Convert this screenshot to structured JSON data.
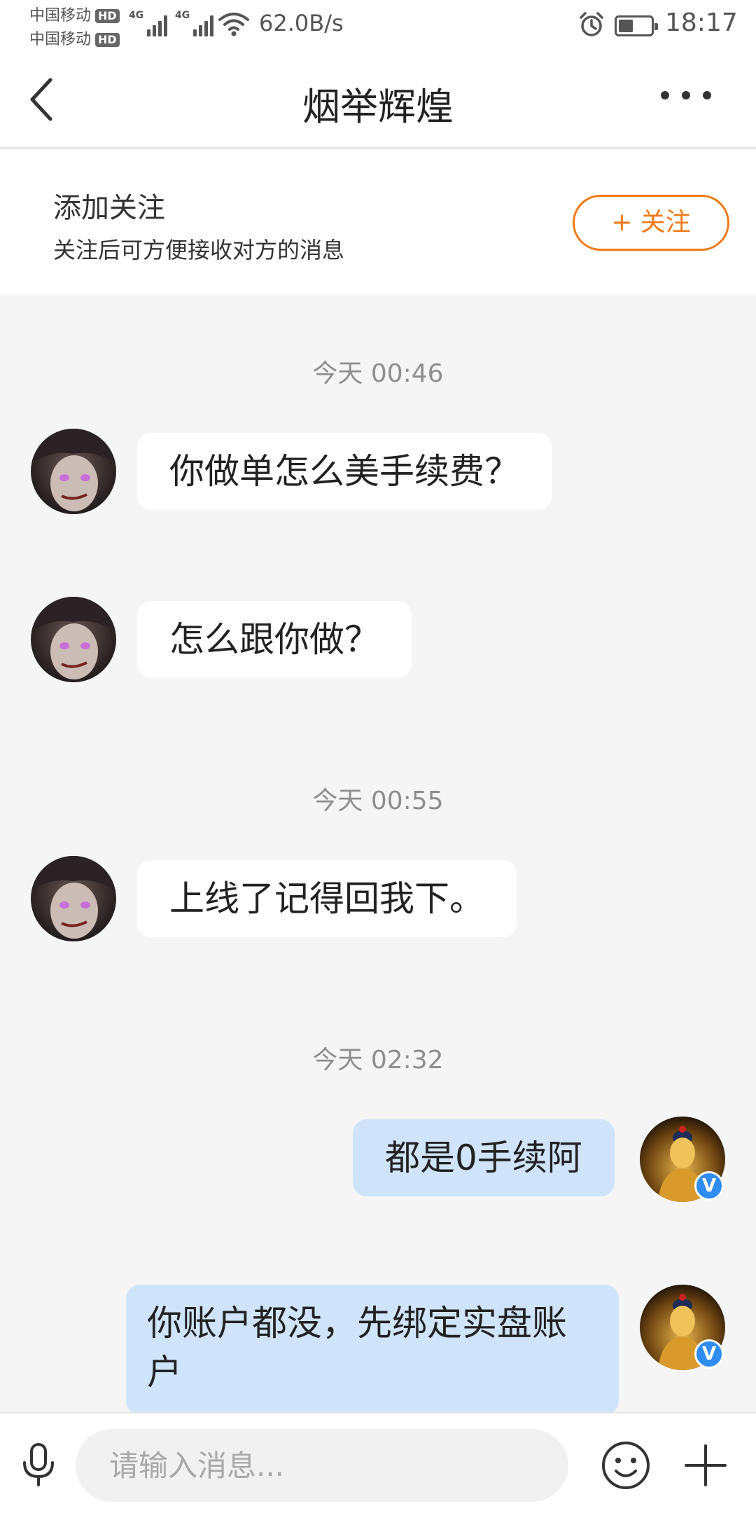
{
  "status_bar": {
    "carrier_1": "中国移动",
    "carrier_2": "中国移动",
    "hd_label": "HD",
    "network_tag": "4G",
    "net_speed": "62.0B/s",
    "time": "18:17"
  },
  "header": {
    "title": "烟举辉煌",
    "back_icon": "chevron-left-icon",
    "more_icon": "more-dots-icon"
  },
  "follow_banner": {
    "title": "添加关注",
    "subtitle": "关注后可方便接收对方的消息",
    "button_label": "+ 关注",
    "accent_color": "#f07a1a"
  },
  "messages": [
    {
      "type": "time",
      "text": "今天 00:46"
    },
    {
      "type": "incoming",
      "text": "你做单怎么美手续费？"
    },
    {
      "type": "incoming",
      "text": "怎么跟你做？"
    },
    {
      "type": "time",
      "text": "今天 00:55"
    },
    {
      "type": "incoming",
      "text": "上线了记得回我下。"
    },
    {
      "type": "time",
      "text": "今天 02:32"
    },
    {
      "type": "outgoing",
      "text": "都是0手续阿"
    },
    {
      "type": "outgoing",
      "text": "你账户都没，先绑定实盘账户"
    }
  ],
  "verified_badge": "V",
  "input_bar": {
    "placeholder": "请输入消息...",
    "mic_icon": "microphone-icon",
    "emoji_icon": "emoji-icon",
    "plus_icon": "plus-icon"
  },
  "colors": {
    "incoming_bubble": "#ffffff",
    "outgoing_bubble": "#cfe4fb",
    "verified_badge": "#2f8df0"
  }
}
